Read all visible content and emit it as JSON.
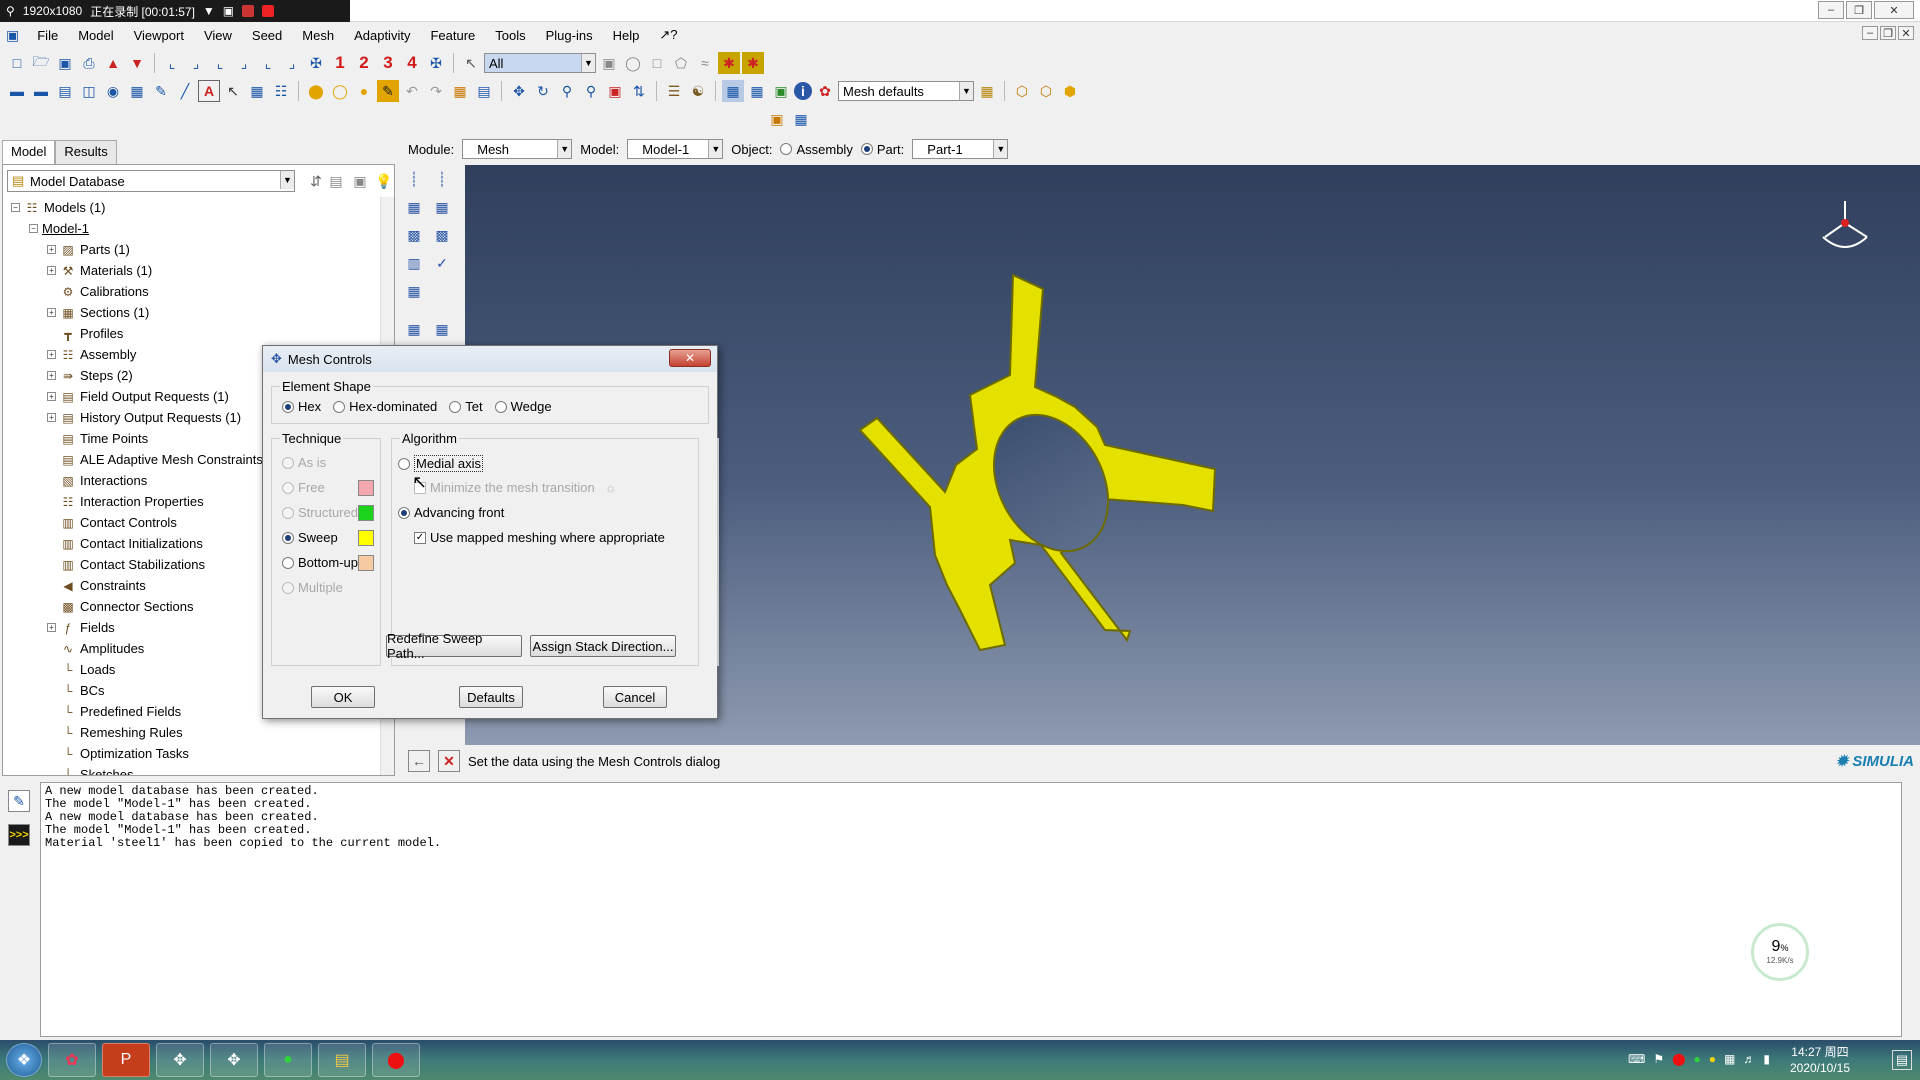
{
  "recorder": {
    "resolution": "1920x1080",
    "status": "正在录制 [00:01:57]"
  },
  "menu": [
    "File",
    "Model",
    "Viewport",
    "View",
    "Seed",
    "Mesh",
    "Adaptivity",
    "Feature",
    "Tools",
    "Plug-ins",
    "Help",
    "↗?"
  ],
  "toolbar": {
    "numbers": [
      "1",
      "2",
      "3",
      "4"
    ],
    "select_filter": "All",
    "mesh_defaults": "Mesh defaults"
  },
  "tabs": [
    "Model",
    "Results"
  ],
  "tree": {
    "root_combo": "Model Database",
    "items": [
      {
        "label": "Models (1)",
        "level": 0,
        "pm": "-",
        "icon": "☷"
      },
      {
        "label": "Model-1",
        "level": 1,
        "pm": "-",
        "icon": "",
        "underline": true
      },
      {
        "label": "Parts (1)",
        "level": 2,
        "pm": "+",
        "icon": "▨"
      },
      {
        "label": "Materials (1)",
        "level": 2,
        "pm": "+",
        "icon": "⚒"
      },
      {
        "label": "Calibrations",
        "level": 2,
        "pm": "",
        "icon": "⚙"
      },
      {
        "label": "Sections (1)",
        "level": 2,
        "pm": "+",
        "icon": "▦"
      },
      {
        "label": "Profiles",
        "level": 2,
        "pm": "",
        "icon": "┳"
      },
      {
        "label": "Assembly",
        "level": 2,
        "pm": "+",
        "icon": "☷"
      },
      {
        "label": "Steps (2)",
        "level": 2,
        "pm": "+",
        "icon": "⇛"
      },
      {
        "label": "Field Output Requests (1)",
        "level": 2,
        "pm": "+",
        "icon": "▤"
      },
      {
        "label": "History Output Requests (1)",
        "level": 2,
        "pm": "+",
        "icon": "▤"
      },
      {
        "label": "Time Points",
        "level": 2,
        "pm": "",
        "icon": "▤"
      },
      {
        "label": "ALE Adaptive Mesh Constraints",
        "level": 2,
        "pm": "",
        "icon": "▤"
      },
      {
        "label": "Interactions",
        "level": 2,
        "pm": "",
        "icon": "▧"
      },
      {
        "label": "Interaction Properties",
        "level": 2,
        "pm": "",
        "icon": "☷"
      },
      {
        "label": "Contact Controls",
        "level": 2,
        "pm": "",
        "icon": "▥"
      },
      {
        "label": "Contact Initializations",
        "level": 2,
        "pm": "",
        "icon": "▥"
      },
      {
        "label": "Contact Stabilizations",
        "level": 2,
        "pm": "",
        "icon": "▥"
      },
      {
        "label": "Constraints",
        "level": 2,
        "pm": "",
        "icon": "◀"
      },
      {
        "label": "Connector Sections",
        "level": 2,
        "pm": "",
        "icon": "▩"
      },
      {
        "label": "Fields",
        "level": 2,
        "pm": "+",
        "icon": "ƒ"
      },
      {
        "label": "Amplitudes",
        "level": 2,
        "pm": "",
        "icon": "∿"
      },
      {
        "label": "Loads",
        "level": 2,
        "pm": "",
        "icon": "└"
      },
      {
        "label": "BCs",
        "level": 2,
        "pm": "",
        "icon": "└"
      },
      {
        "label": "Predefined Fields",
        "level": 2,
        "pm": "",
        "icon": "└"
      },
      {
        "label": "Remeshing Rules",
        "level": 2,
        "pm": "",
        "icon": "└"
      },
      {
        "label": "Optimization Tasks",
        "level": 2,
        "pm": "",
        "icon": "└"
      },
      {
        "label": "Sketches",
        "level": 2,
        "pm": "",
        "icon": "└"
      }
    ]
  },
  "context": {
    "module_label": "Module:",
    "module": "Mesh",
    "model_label": "Model:",
    "model": "Model-1",
    "object_label": "Object:",
    "assembly": "Assembly",
    "part_label": "Part:",
    "part": "Part-1"
  },
  "prompt": "Set the data using the Mesh Controls dialog",
  "brand": "SIMULIA",
  "messages": [
    "A new model database has been created.",
    "The model \"Model-1\" has been created.",
    "A new model database has been created.",
    "The model \"Model-1\" has been created.",
    "Material 'steel1' has been copied to the current model."
  ],
  "dialog": {
    "title": "Mesh Controls",
    "element_shape_title": "Element Shape",
    "shapes": [
      "Hex",
      "Hex-dominated",
      "Tet",
      "Wedge"
    ],
    "technique_title": "Technique",
    "techniques": [
      {
        "label": "As is",
        "enabled": false,
        "color": ""
      },
      {
        "label": "Free",
        "enabled": false,
        "color": "#f5a7b0"
      },
      {
        "label": "Structured",
        "enabled": false,
        "color": "#1bd31b"
      },
      {
        "label": "Sweep",
        "enabled": true,
        "selected": true,
        "color": "#ffff00"
      },
      {
        "label": "Bottom-up",
        "enabled": true,
        "color": "#f6cba1"
      },
      {
        "label": "Multiple",
        "enabled": false,
        "color": ""
      }
    ],
    "algorithm_title": "Algorithm",
    "medial_axis": "Medial axis",
    "minimize": "Minimize the mesh transition",
    "advancing_front": "Advancing front",
    "use_mapped": "Use mapped meshing where appropriate",
    "redefine": "Redefine Sweep Path...",
    "assign": "Assign Stack Direction...",
    "ok": "OK",
    "defaults": "Defaults",
    "cancel": "Cancel"
  },
  "net": {
    "percent": "9",
    "unit": "%",
    "speed": "12.9K/s"
  },
  "clock": {
    "time": "14:27 周四",
    "date": "2020/10/15"
  },
  "colors": {
    "part": "#e4e000",
    "viewport_top": "#2f3f5c"
  }
}
